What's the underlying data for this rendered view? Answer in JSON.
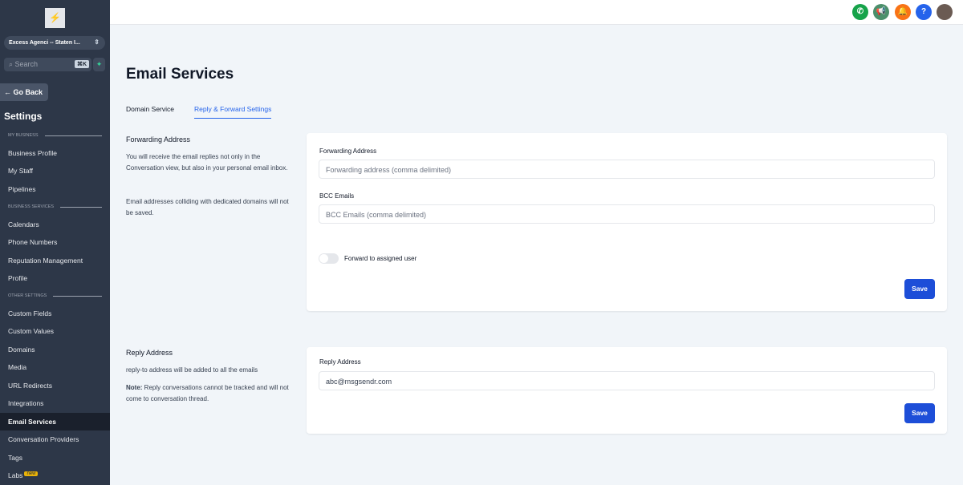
{
  "sidebar": {
    "location": "Excess Agenci -- Staten I...",
    "search_placeholder": "Search",
    "shortcut": "⌘K",
    "go_back": "Go Back",
    "title": "Settings",
    "sections": [
      "MY BUSINESS",
      "BUSINESS SERVICES",
      "OTHER SETTINGS"
    ],
    "items": [
      "Business Profile",
      "My Staff",
      "Pipelines",
      "Calendars",
      "Phone Numbers",
      "Reputation Management",
      "Profile",
      "Custom Fields",
      "Custom Values",
      "Domains",
      "Media",
      "URL Redirects",
      "Integrations",
      "Email Services",
      "Conversation Providers",
      "Tags",
      "Labs"
    ],
    "labs_badge": "new"
  },
  "page": {
    "title": "Email Services",
    "tabs": [
      "Domain Service",
      "Reply & Forward Settings"
    ]
  },
  "forwarding": {
    "title": "Forwarding Address",
    "desc1": "You will receive the email replies not only in the Conversation view, but also in your personal email inbox.",
    "desc2": "Email addresses colliding with dedicated domains will not be saved.",
    "field1_label": "Forwarding Address",
    "field1_placeholder": "Forwarding address (comma delimited)",
    "field2_label": "BCC Emails",
    "field2_placeholder": "BCC Emails (comma delimited)",
    "toggle_label": "Forward to assigned user",
    "toggle_on": false,
    "save": "Save"
  },
  "reply": {
    "title": "Reply Address",
    "desc": "reply-to address will be added to all the emails",
    "note_label": "Note:",
    "note": " Reply conversations cannot be tracked and will not come to conversation thread.",
    "field_label": "Reply Address",
    "field_value": "abc@msgsendr.com",
    "save": "Save"
  }
}
